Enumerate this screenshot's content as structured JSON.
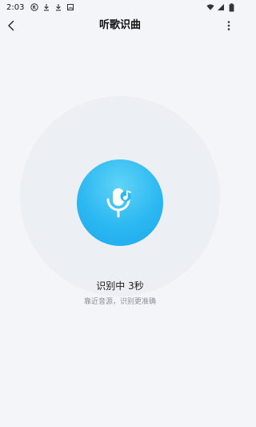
{
  "status_bar": {
    "time": "2:03",
    "notification_icons": [
      "k-badge-icon",
      "download-icon",
      "download-icon",
      "photo-icon"
    ],
    "system_icons": [
      "wifi-icon",
      "cell-signal-icon",
      "battery-icon"
    ]
  },
  "header": {
    "title": "听歌识曲",
    "back_icon": "chevron-left-icon",
    "more_icon": "more-vertical-icon"
  },
  "recognizer": {
    "icon": "microphone-music-icon",
    "status": "识别中 3秒",
    "hint": "靠近音源，识别更准确"
  },
  "colors": {
    "background": "#f4f5f9",
    "accent_light": "#5fd3f7",
    "accent": "#1aa9ec",
    "halo": "#eaedf2",
    "hint_text": "#8a8f99"
  }
}
